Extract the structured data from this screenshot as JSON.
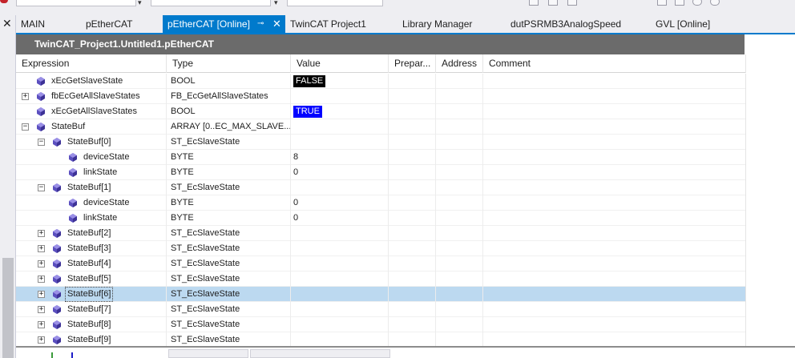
{
  "tabs": [
    {
      "label": "MAIN",
      "active": false
    },
    {
      "label": "pEtherCAT",
      "active": false
    },
    {
      "label": "pEtherCAT [Online]",
      "active": true
    },
    {
      "label": "TwinCAT Project1",
      "active": false
    },
    {
      "label": "Library Manager",
      "active": false
    },
    {
      "label": "dutPSRMB3AnalogSpeed",
      "active": false
    },
    {
      "label": "GVL [Online]",
      "active": false
    }
  ],
  "document": {
    "title": "TwinCAT_Project1.Untitled1.pEtherCAT"
  },
  "grid": {
    "columns": [
      "Expression",
      "Type",
      "Value",
      "Prepar...",
      "Address",
      "Comment"
    ],
    "rows": [
      {
        "name": "xEcGetSlaveState",
        "type": "BOOL",
        "value": "FALSE",
        "expander": "",
        "level": 0,
        "value_style": "false"
      },
      {
        "name": "fbEcGetAllSlaveStates",
        "type": "FB_EcGetAllSlaveStates",
        "value": "",
        "expander": "+",
        "level": 0,
        "value_style": ""
      },
      {
        "name": "xEcGetAllSlaveStates",
        "type": "BOOL",
        "value": "TRUE",
        "expander": "",
        "level": 0,
        "value_style": "true"
      },
      {
        "name": "StateBuf",
        "type": "ARRAY [0..EC_MAX_SLAVE...",
        "value": "",
        "expander": "−",
        "level": 0,
        "value_style": ""
      },
      {
        "name": "StateBuf[0]",
        "type": "ST_EcSlaveState",
        "value": "",
        "expander": "−",
        "level": 1,
        "value_style": ""
      },
      {
        "name": "deviceState",
        "type": "BYTE",
        "value": "8",
        "expander": "",
        "level": 2,
        "value_style": ""
      },
      {
        "name": "linkState",
        "type": "BYTE",
        "value": "0",
        "expander": "",
        "level": 2,
        "value_style": ""
      },
      {
        "name": "StateBuf[1]",
        "type": "ST_EcSlaveState",
        "value": "",
        "expander": "−",
        "level": 1,
        "value_style": ""
      },
      {
        "name": "deviceState",
        "type": "BYTE",
        "value": "0",
        "expander": "",
        "level": 2,
        "value_style": ""
      },
      {
        "name": "linkState",
        "type": "BYTE",
        "value": "0",
        "expander": "",
        "level": 2,
        "value_style": ""
      },
      {
        "name": "StateBuf[2]",
        "type": "ST_EcSlaveState",
        "value": "",
        "expander": "+",
        "level": 1,
        "value_style": ""
      },
      {
        "name": "StateBuf[3]",
        "type": "ST_EcSlaveState",
        "value": "",
        "expander": "+",
        "level": 1,
        "value_style": ""
      },
      {
        "name": "StateBuf[4]",
        "type": "ST_EcSlaveState",
        "value": "",
        "expander": "+",
        "level": 1,
        "value_style": ""
      },
      {
        "name": "StateBuf[5]",
        "type": "ST_EcSlaveState",
        "value": "",
        "expander": "+",
        "level": 1,
        "value_style": ""
      },
      {
        "name": "StateBuf[6]",
        "type": "ST_EcSlaveState",
        "value": "",
        "expander": "+",
        "level": 1,
        "value_style": "",
        "selected": true
      },
      {
        "name": "StateBuf[7]",
        "type": "ST_EcSlaveState",
        "value": "",
        "expander": "+",
        "level": 1,
        "value_style": ""
      },
      {
        "name": "StateBuf[8]",
        "type": "ST_EcSlaveState",
        "value": "",
        "expander": "+",
        "level": 1,
        "value_style": ""
      },
      {
        "name": "StateBuf[9]",
        "type": "ST_EcSlaveState",
        "value": "",
        "expander": "+",
        "level": 1,
        "value_style": ""
      }
    ]
  },
  "icons": {
    "close": "close-icon",
    "pin": "pin-icon",
    "variable": "variable-icon",
    "expand": "plus-icon",
    "collapse": "minus-icon"
  },
  "colors": {
    "accent": "#007acc",
    "selection": "#bcd9f0",
    "false_bg": "#000000",
    "true_bg": "#0000ff",
    "header_bg": "#6b6b6b"
  }
}
